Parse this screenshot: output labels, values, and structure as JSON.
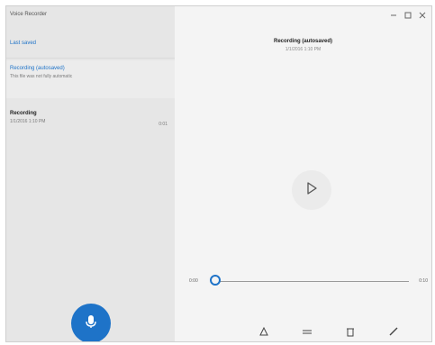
{
  "app": {
    "title": "Voice Recorder"
  },
  "sidebar": {
    "top_label": "Last saved",
    "items": [
      {
        "title": "Recording (autosaved)",
        "subtitle": "This file was not fully automatic",
        "duration": ""
      },
      {
        "title": "Recording",
        "subtitle": "1/1/2016 1:10 PM",
        "duration": "0:01"
      }
    ]
  },
  "detail": {
    "title": "Recording (autosaved)",
    "date": "1/1/2016 1:10 PM",
    "time_elapsed": "0:00",
    "time_total": "0:10"
  },
  "colors": {
    "accent": "#1e73c8"
  },
  "icons": {
    "record": "microphone-icon",
    "play": "play-icon",
    "share": "share-icon",
    "trim": "trim-icon",
    "delete": "delete-icon",
    "rename": "edit-icon"
  }
}
